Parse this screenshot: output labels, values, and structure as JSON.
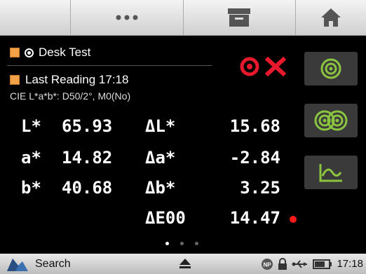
{
  "toolbar": {
    "menu_icon": "more-horizontal-icon",
    "archive_icon": "archive-icon",
    "home_icon": "home-icon"
  },
  "header": {
    "standard_label": "Desk Test",
    "sample_label": "Last Reading 17:18",
    "colorspace_label": "CIE L*a*b*: D50/2°, M0(No)",
    "swatch_color": "#f2a149"
  },
  "result": {
    "status_icon": "fail-icon",
    "status_color": "#e8192c"
  },
  "measurements": {
    "rows": [
      {
        "label": "L*",
        "value": "65.93",
        "delta_label": "ΔL*",
        "delta_value": "15.68"
      },
      {
        "label": "a*",
        "value": "14.82",
        "delta_label": "Δa*",
        "delta_value": "-2.84"
      },
      {
        "label": "b*",
        "value": "40.68",
        "delta_label": "Δb*",
        "delta_value": "3.25"
      }
    ],
    "de_label": "ΔE00",
    "de_value": "14.47"
  },
  "side_buttons": [
    {
      "icon": "target-icon"
    },
    {
      "icon": "compare-targets-icon"
    },
    {
      "icon": "spectral-curve-icon"
    }
  ],
  "pagination": {
    "current": 1,
    "total": 3
  },
  "statusbar": {
    "search_label": "Search",
    "time": "17:18",
    "accent_color": "#8bc53f"
  }
}
